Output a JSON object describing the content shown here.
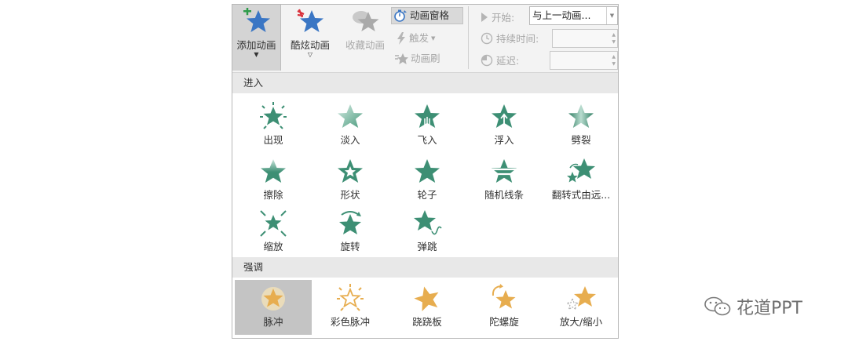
{
  "ribbon": {
    "add_animation": "添加动画",
    "cool_animation": "酷炫动画",
    "favorite_animation": "收藏动画",
    "animation_pane": "动画窗格",
    "trigger": "触发",
    "animation_painter": "动画刷",
    "start_label": "开始:",
    "start_value": "与上一动画...",
    "duration_label": "持续时间:",
    "delay_label": "延迟:"
  },
  "gallery": {
    "enter_title": "进入",
    "enter_items": [
      "出现",
      "淡入",
      "飞入",
      "浮入",
      "劈裂",
      "擦除",
      "形状",
      "轮子",
      "随机线条",
      "翻转式由远...",
      "缩放",
      "旋转",
      "弹跳"
    ],
    "emphasis_title": "强调",
    "emphasis_items": [
      "脉冲",
      "彩色脉冲",
      "跷跷板",
      "陀螺旋",
      "放大/缩小"
    ]
  },
  "watermark": {
    "text": "花道PPT"
  },
  "colors": {
    "enter_icon": "#3d8f74",
    "emphasis_icon": "#e7ad4f",
    "ribbon_star": "#3a76c4",
    "selected_bg": "#c4c4c4"
  }
}
